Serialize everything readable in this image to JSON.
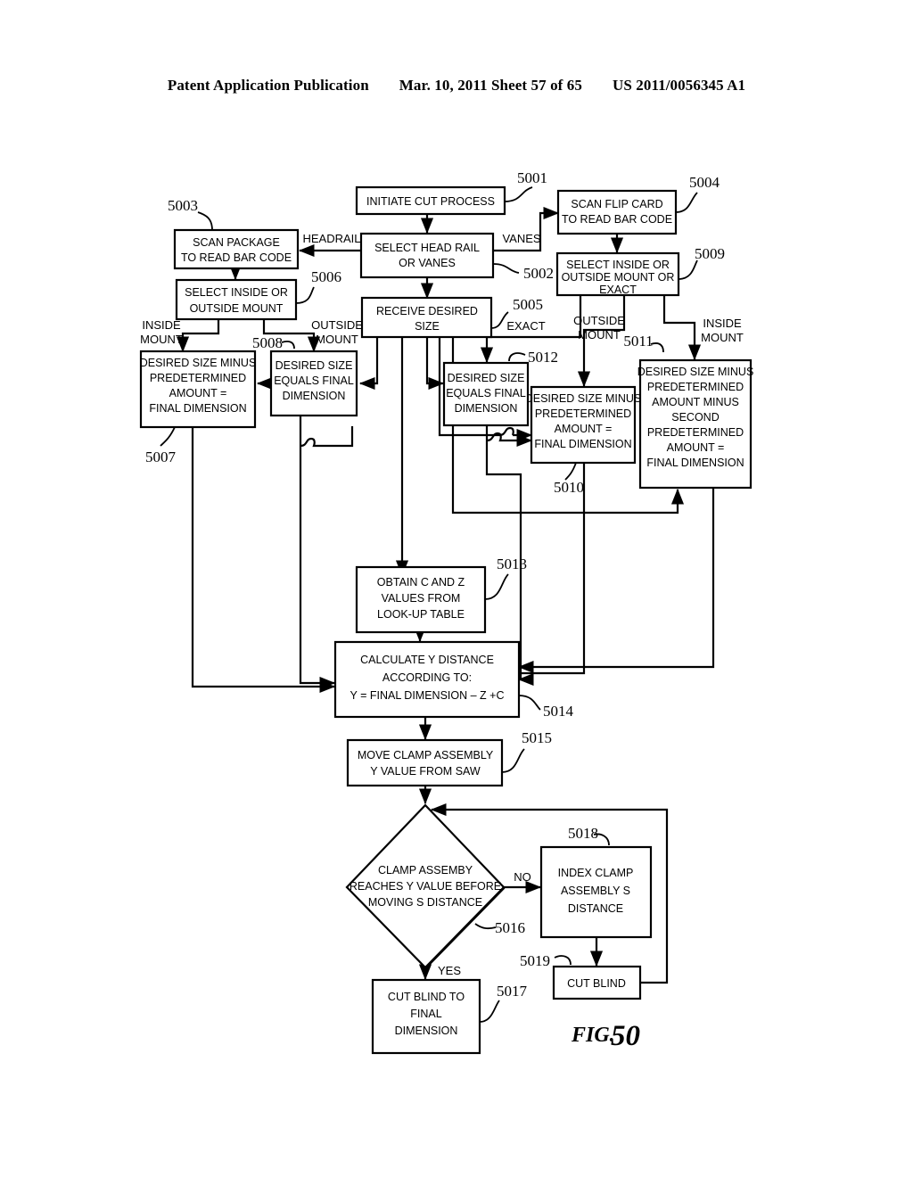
{
  "header": {
    "publication": "Patent Application Publication",
    "date_sheet": "Mar. 10, 2011  Sheet 57 of 65",
    "patent_number": "US 2011/0056345 A1"
  },
  "figure": {
    "label_prefix": "FIG.",
    "label_number": "50"
  },
  "nodes": [
    {
      "id": "5001",
      "ref": "5001",
      "shape": "rect",
      "lines": [
        "INITIATE CUT PROCESS"
      ]
    },
    {
      "id": "5002",
      "ref": "5002",
      "shape": "rect",
      "lines": [
        "SELECT HEAD RAIL",
        "OR VANES"
      ]
    },
    {
      "id": "5003",
      "ref": "5003",
      "shape": "rect",
      "lines": [
        "SCAN PACKAGE",
        "TO READ BAR CODE"
      ]
    },
    {
      "id": "5004",
      "ref": "5004",
      "shape": "rect",
      "lines": [
        "SCAN FLIP CARD",
        "TO READ BAR CODE"
      ]
    },
    {
      "id": "5005",
      "ref": "5005",
      "shape": "rect",
      "lines": [
        "RECEIVE DESIRED",
        "SIZE"
      ]
    },
    {
      "id": "5006",
      "ref": "5006",
      "shape": "rect",
      "lines": [
        "SELECT INSIDE OR",
        "OUTSIDE MOUNT"
      ]
    },
    {
      "id": "5007",
      "ref": "5007",
      "shape": "rect",
      "lines": [
        "DESIRED SIZE MINUS",
        "PREDETERMINED",
        "AMOUNT =",
        "FINAL DIMENSION"
      ]
    },
    {
      "id": "5008",
      "ref": "5008",
      "shape": "rect",
      "lines": [
        "DESIRED SIZE",
        "EQUALS FINAL",
        "DIMENSION"
      ]
    },
    {
      "id": "5009",
      "ref": "5009",
      "shape": "rect",
      "lines": [
        "SELECT INSIDE OR",
        "OUTSIDE MOUNT OR",
        "EXACT"
      ]
    },
    {
      "id": "5010",
      "ref": "5010",
      "shape": "rect",
      "lines": [
        "DESIRED SIZE MINUS",
        "PREDETERMINED",
        "AMOUNT =",
        "FINAL DIMENSION"
      ]
    },
    {
      "id": "5011",
      "ref": "5011",
      "shape": "rect",
      "lines": [
        "DESIRED SIZE MINUS",
        "PREDETERMINED",
        "AMOUNT MINUS",
        "SECOND",
        "PREDETERMINED",
        "AMOUNT =",
        "FINAL DIMENSION"
      ]
    },
    {
      "id": "5012",
      "ref": "5012",
      "shape": "rect",
      "lines": [
        "DESIRED SIZE",
        "EQUALS FINAL",
        "DIMENSION"
      ]
    },
    {
      "id": "5013",
      "ref": "5013",
      "shape": "rect",
      "lines": [
        "OBTAIN C AND Z",
        "VALUES FROM",
        "LOOK-UP TABLE"
      ]
    },
    {
      "id": "5014",
      "ref": "5014",
      "shape": "rect",
      "lines": [
        "CALCULATE Y DISTANCE",
        "ACCORDING TO:",
        "Y = FINAL DIMENSION – Z +C"
      ]
    },
    {
      "id": "5015",
      "ref": "5015",
      "shape": "rect",
      "lines": [
        "MOVE CLAMP ASSEMBLY",
        "Y VALUE FROM SAW"
      ]
    },
    {
      "id": "5016",
      "ref": "5016",
      "shape": "diamond",
      "lines": [
        "CLAMP ASSEMBY",
        "REACHES Y VALUE BEFORE",
        "MOVING S DISTANCE"
      ]
    },
    {
      "id": "5017",
      "ref": "5017",
      "shape": "rect",
      "lines": [
        "CUT BLIND TO",
        "FINAL",
        "DIMENSION"
      ]
    },
    {
      "id": "5018",
      "ref": "5018",
      "shape": "rect",
      "lines": [
        "INDEX CLAMP",
        "ASSEMBLY S",
        "DISTANCE"
      ]
    },
    {
      "id": "5019",
      "ref": "5019",
      "shape": "rect",
      "lines": [
        "CUT BLIND"
      ]
    }
  ],
  "edge_labels": [
    {
      "id": "headrail",
      "text": "HEADRAIL"
    },
    {
      "id": "vanes",
      "text": "VANES"
    },
    {
      "id": "inside-mount-left",
      "text_line1": "INSIDE",
      "text_line2": "MOUNT"
    },
    {
      "id": "outside-mount-left",
      "text_line1": "OUTSIDE",
      "text_line2": "MOUNT"
    },
    {
      "id": "exact",
      "text": "EXACT"
    },
    {
      "id": "outside-mount-right",
      "text_line1": "OUTSIDE",
      "text_line2": "MOUNT"
    },
    {
      "id": "inside-mount-right",
      "text_line1": "INSIDE",
      "text_line2": "MOUNT"
    },
    {
      "id": "no",
      "text": "NO"
    },
    {
      "id": "yes",
      "text": "YES"
    }
  ]
}
